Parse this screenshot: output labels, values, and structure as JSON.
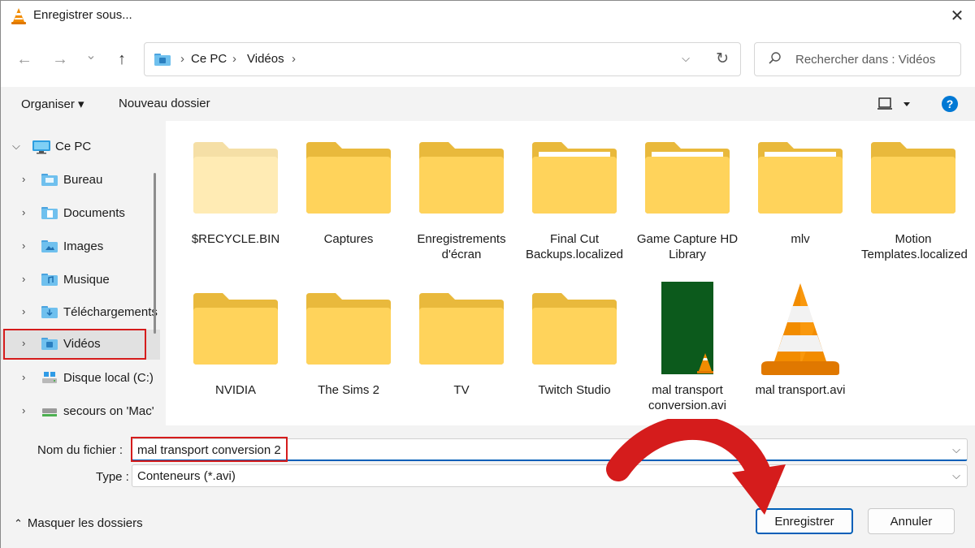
{
  "window": {
    "title": "Enregistrer sous...",
    "close_label": "✕"
  },
  "nav": {
    "back": "←",
    "forward": "→",
    "recent": "⌄",
    "up": "↑",
    "breadcrumb": [
      "Ce PC",
      "Vidéos"
    ],
    "sep": "›",
    "search_placeholder": "Rechercher dans : Vidéos"
  },
  "toolbar": {
    "organize_label": "Organiser ▾",
    "new_folder_label": "Nouveau dossier",
    "help_label": "?"
  },
  "sidebar": {
    "items": [
      {
        "label": "Ce PC",
        "expanded": true,
        "icon": "computer-icon"
      },
      {
        "label": "Bureau",
        "icon": "desktop-folder-icon"
      },
      {
        "label": "Documents",
        "icon": "documents-folder-icon"
      },
      {
        "label": "Images",
        "icon": "pictures-folder-icon"
      },
      {
        "label": "Musique",
        "icon": "music-folder-icon"
      },
      {
        "label": "Téléchargements",
        "icon": "downloads-folder-icon"
      },
      {
        "label": "Vidéos",
        "icon": "videos-folder-icon",
        "selected": true
      },
      {
        "label": "Disque local (C:)",
        "icon": "drive-icon"
      },
      {
        "label": "secours on 'Mac'",
        "icon": "network-drive-icon"
      }
    ]
  },
  "files": [
    {
      "name": "$RECYCLE.BIN",
      "type": "folder",
      "faded": true
    },
    {
      "name": "Captures",
      "type": "folder"
    },
    {
      "name": "Enregistrements d'écran",
      "type": "folder"
    },
    {
      "name": "Final Cut Backups.localized",
      "type": "folder"
    },
    {
      "name": "Game Capture HD Library",
      "type": "folder"
    },
    {
      "name": "mlv",
      "type": "folder"
    },
    {
      "name": "Motion Templates.localized",
      "type": "folder"
    },
    {
      "name": "NVIDIA",
      "type": "folder"
    },
    {
      "name": "The Sims 2",
      "type": "folder"
    },
    {
      "name": "TV",
      "type": "folder"
    },
    {
      "name": "Twitch Studio",
      "type": "folder"
    },
    {
      "name": "mal transport conversion.avi",
      "type": "video-thumbnail"
    },
    {
      "name": "mal transport.avi",
      "type": "vlc-file"
    }
  ],
  "form": {
    "filename_label": "Nom du fichier :",
    "filename_value": "mal transport conversion 2",
    "type_label": "Type :",
    "type_value": "Conteneurs (*.avi)",
    "save_label": "Enregistrer",
    "cancel_label": "Annuler",
    "hide_folders_label": "Masquer les dossiers"
  },
  "colors": {
    "accent": "#005fb8",
    "annotation": "#d51c1c",
    "folder": "#ffd35b",
    "vlc_orange": "#f28c00"
  }
}
